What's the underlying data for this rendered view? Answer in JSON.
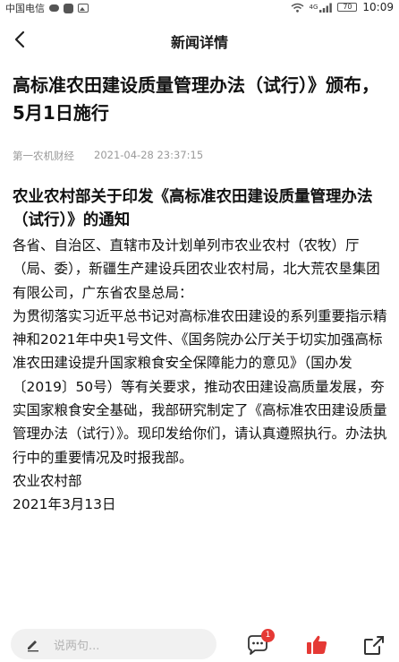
{
  "status_bar": {
    "carrier": "中国电信",
    "network": "4G",
    "battery": "70",
    "time": "10:09"
  },
  "nav": {
    "title": "新闻详情"
  },
  "article": {
    "title": "高标准农田建设质量管理办法（试行）》颁布，5月1日施行",
    "source": "第一农机财经",
    "datetime": "2021-04-28 23:37:15",
    "doc_heading": "农业农村部关于印发《高标准农田建设质量管理办法（试行）》的通知",
    "paragraphs": [
      "各省、自治区、直辖市及计划单列市农业农村（农牧）厅（局、委），新疆生产建设兵团农业农村局，北大荒农垦集团有限公司，广东省农垦总局：",
      "为贯彻落实习近平总书记对高标准农田建设的系列重要指示精神和2021年中央1号文件、《国务院办公厅关于切实加强高标准农田建设提升国家粮食安全保障能力的意见》（国办发〔2019〕50号）等有关要求，推动农田建设高质量发展，夯实国家粮食安全基础，我部研究制定了《高标准农田建设质量管理办法（试行）》。现印发给你们，请认真遵照执行。办法执行中的重要情况及时报我部。",
      "农业农村部",
      "2021年3月13日"
    ]
  },
  "bottom_bar": {
    "comment_placeholder": "说两句...",
    "comment_count": "1"
  },
  "colors": {
    "accent_red": "#e53935",
    "meta_gray": "#9a9a9a",
    "input_bg": "#f1f1f1"
  },
  "icons": [
    "chat-bubble-icon",
    "app-icon",
    "image-icon",
    "wifi-icon",
    "signal-icon",
    "battery-icon",
    "back-arrow-icon",
    "pen-icon",
    "comment-icon",
    "thumbs-up-icon",
    "share-icon"
  ]
}
